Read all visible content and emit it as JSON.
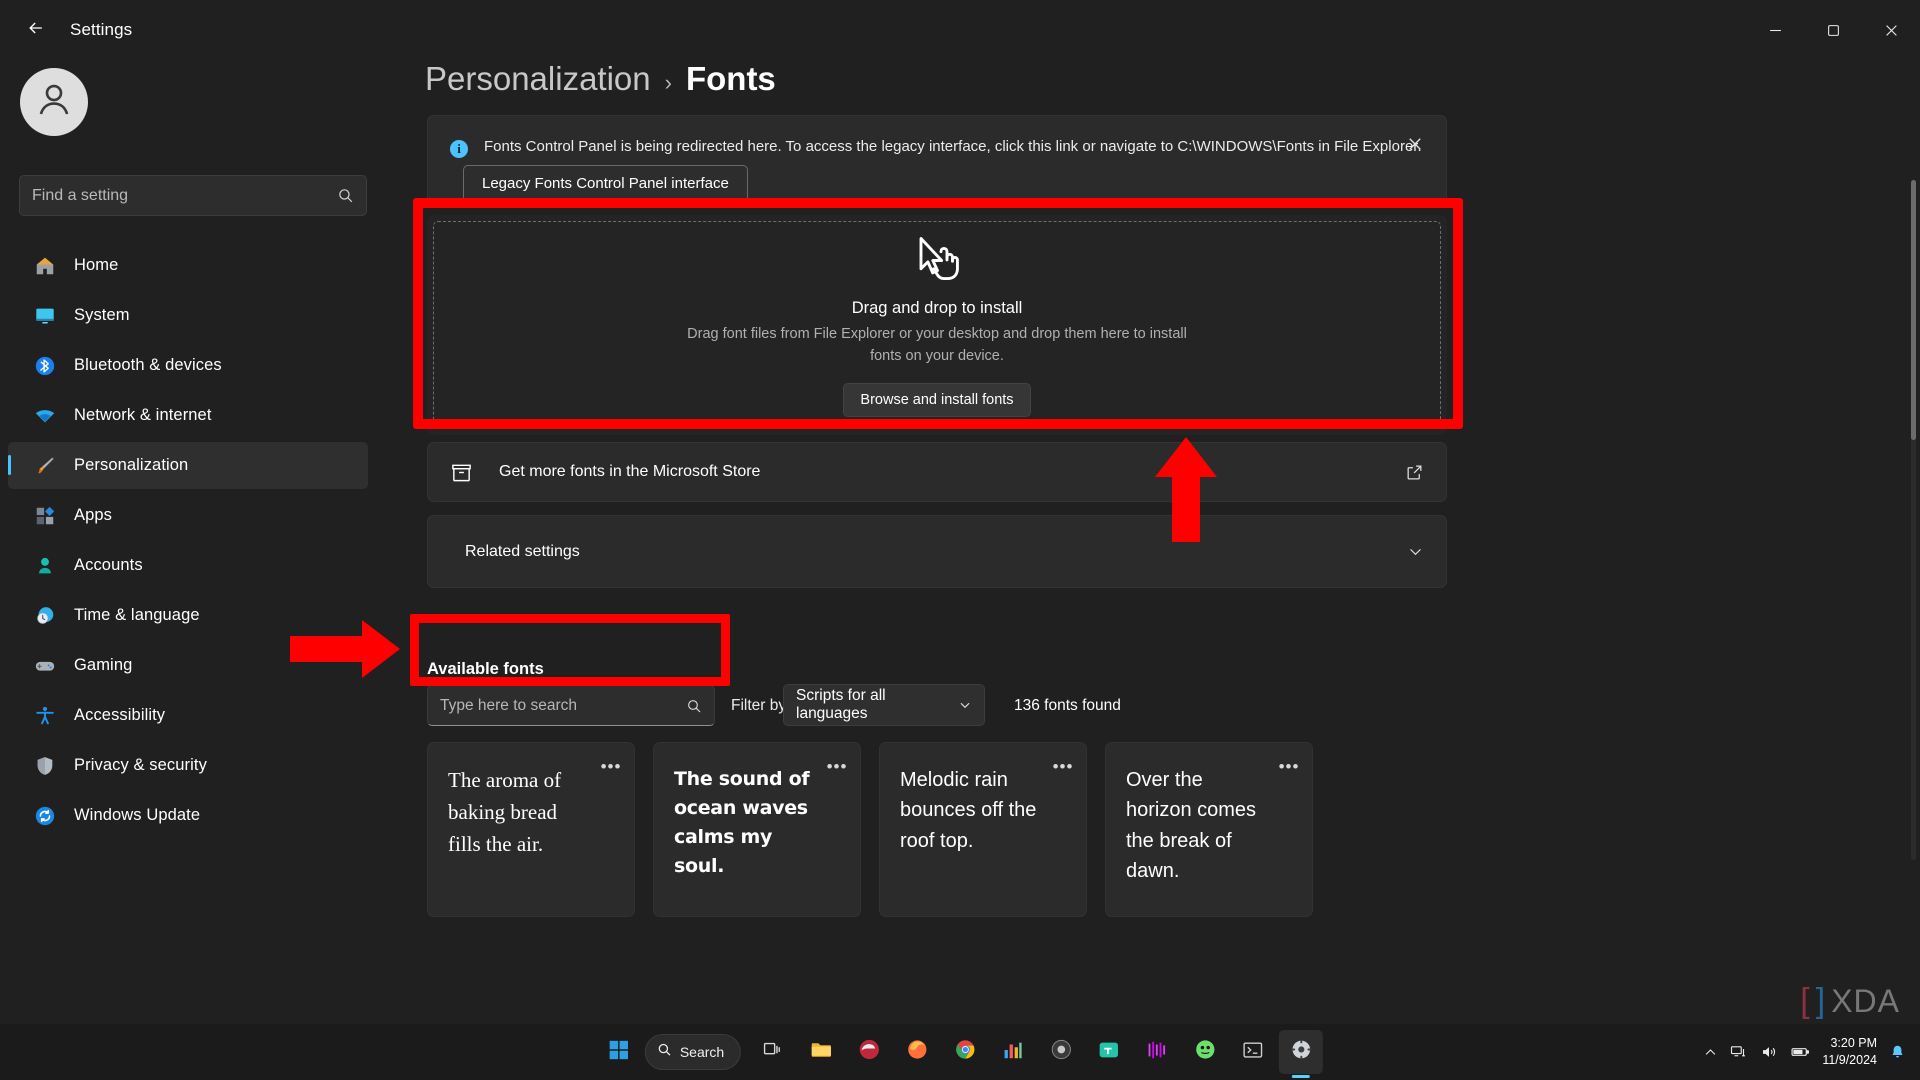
{
  "window": {
    "title": "Settings",
    "back_icon": "back-arrow-icon",
    "minimize_label": "Minimize",
    "maximize_label": "Maximize",
    "close_label": "Close"
  },
  "sidebar": {
    "search": {
      "placeholder": "Find a setting",
      "icon": "search-icon"
    },
    "avatar_icon": "user-avatar-icon",
    "items": [
      {
        "label": "Home",
        "icon": "home-icon",
        "active": false
      },
      {
        "label": "System",
        "icon": "system-icon",
        "active": false
      },
      {
        "label": "Bluetooth & devices",
        "icon": "bluetooth-icon",
        "active": false
      },
      {
        "label": "Network & internet",
        "icon": "wifi-icon",
        "active": false
      },
      {
        "label": "Personalization",
        "icon": "paintbrush-icon",
        "active": true
      },
      {
        "label": "Apps",
        "icon": "apps-icon",
        "active": false
      },
      {
        "label": "Accounts",
        "icon": "accounts-icon",
        "active": false
      },
      {
        "label": "Time & language",
        "icon": "clock-globe-icon",
        "active": false
      },
      {
        "label": "Gaming",
        "icon": "gamepad-icon",
        "active": false
      },
      {
        "label": "Accessibility",
        "icon": "accessibility-icon",
        "active": false
      },
      {
        "label": "Privacy & security",
        "icon": "shield-icon",
        "active": false
      },
      {
        "label": "Windows Update",
        "icon": "update-icon",
        "active": false
      }
    ]
  },
  "breadcrumb": {
    "parent": "Personalization",
    "separator": "›",
    "current": "Fonts"
  },
  "banner": {
    "icon": "info-icon",
    "text": "Fonts Control Panel is being redirected here. To access the legacy interface, click this link or navigate to C:\\WINDOWS\\Fonts in File Explorer.",
    "link_button": "Legacy Fonts Control Panel interface",
    "close_icon": "close-icon"
  },
  "drop_zone": {
    "cursor_icon": "drag-cursor-icon",
    "title": "Drag and drop to install",
    "subtitle": "Drag font files from File Explorer or your desktop and drop them here to install fonts on your device.",
    "browse_button": "Browse and install fonts"
  },
  "store_row": {
    "icon": "microsoft-store-icon",
    "label": "Get more fonts in the Microsoft Store",
    "action_icon": "external-link-icon"
  },
  "related_settings": {
    "label": "Related settings",
    "chevron_icon": "chevron-down-icon"
  },
  "available_fonts": {
    "title": "Available fonts",
    "search_placeholder": "Type here to search",
    "search_icon": "search-icon",
    "filter_label": "Filter by:",
    "filter_value": "Scripts for all languages",
    "filter_chevron_icon": "chevron-down-icon",
    "count_text": "136 fonts found",
    "cards": [
      {
        "preview": "The aroma of baking bread fills the air.",
        "style": "serif",
        "menu_icon": "more-options-icon"
      },
      {
        "preview": "The sound of ocean waves calms my soul.",
        "style": "bold",
        "menu_icon": "more-options-icon"
      },
      {
        "preview": "Melodic rain bounces off the roof top.",
        "style": "sans",
        "menu_icon": "more-options-icon"
      },
      {
        "preview": "Over the horizon comes the break of dawn.",
        "style": "sans",
        "menu_icon": "more-options-icon"
      }
    ]
  },
  "annotations": {
    "color": "#ff0000",
    "highlight_drop_zone": "drag-and-drop-area-highlight",
    "highlight_search": "font-search-highlight",
    "arrow_up": "arrow-pointing-up",
    "arrow_right": "arrow-pointing-right"
  },
  "taskbar": {
    "start_icon": "windows-start-icon",
    "search": {
      "label": "Search",
      "icon": "search-icon"
    },
    "apps": [
      "task-view-icon",
      "file-explorer-icon",
      "edge-icon",
      "firefox-icon",
      "chrome-icon",
      "chart-app-icon",
      "record-app-icon",
      "teams-icon",
      "music-app-icon",
      "game-app-icon",
      "terminal-icon",
      "settings-icon"
    ],
    "tray": {
      "chevron_icon": "show-hidden-icons-icon",
      "network_icon": "network-icon",
      "volume_icon": "volume-icon",
      "battery_icon": "battery-icon",
      "time": "3:20 PM",
      "date": "11/9/2024",
      "notification_icon": "notification-bell-icon"
    }
  },
  "watermark": {
    "bracket_left": "[",
    "bracket_right": "]",
    "word": "XDA"
  }
}
